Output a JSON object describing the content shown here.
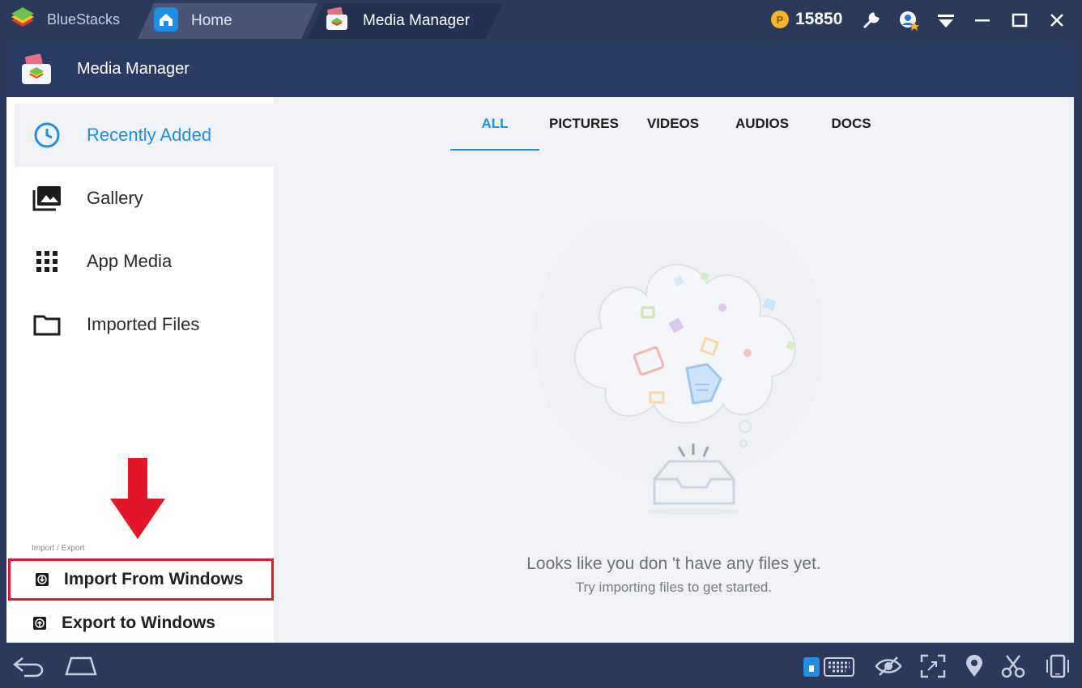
{
  "titlebar": {
    "brand": "BlueStacks",
    "tabs": [
      {
        "label": "Home"
      },
      {
        "label": "Media Manager"
      }
    ],
    "coins": "15850",
    "icons": [
      "wrench-icon",
      "account-icon",
      "dropdown-icon",
      "minimize-icon",
      "maximize-icon",
      "close-icon"
    ]
  },
  "app": {
    "title": "Media Manager"
  },
  "sidebar": {
    "items": [
      {
        "label": "Recently Added",
        "icon": "clock-icon"
      },
      {
        "label": "Gallery",
        "icon": "gallery-icon"
      },
      {
        "label": "App Media",
        "icon": "grid-icon"
      },
      {
        "label": "Imported Files",
        "icon": "folder-icon"
      }
    ],
    "section_caption": "Import / Export",
    "import_label": "Import From Windows",
    "export_label": "Export to Windows"
  },
  "main": {
    "tabs": [
      {
        "label": "ALL"
      },
      {
        "label": "PICTURES"
      },
      {
        "label": "VIDEOS"
      },
      {
        "label": "AUDIOS"
      },
      {
        "label": "DOCS"
      }
    ],
    "empty_title": "Looks like you don 't have any files yet.",
    "empty_subtitle": "Try importing files to get started."
  },
  "colors": {
    "accent": "#1f8ee3",
    "chrome": "#2b3a5a",
    "highlight": "#e3162a"
  }
}
